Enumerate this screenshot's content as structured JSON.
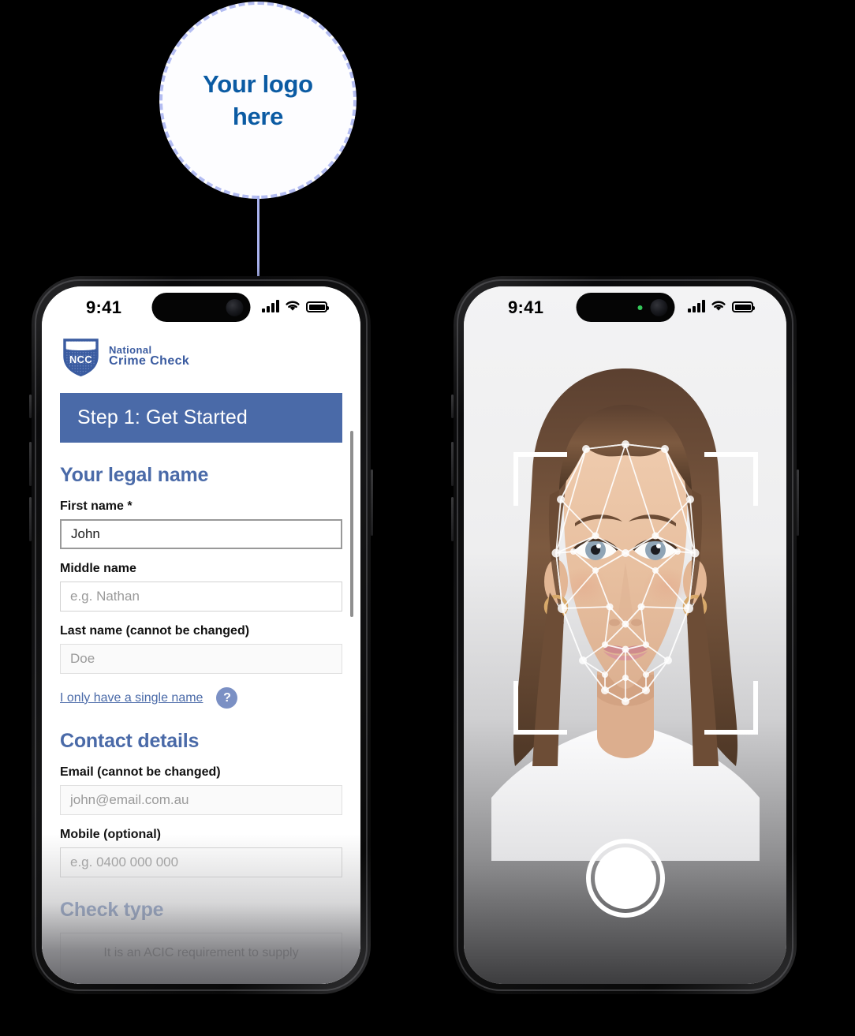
{
  "callout": {
    "line1": "Your logo",
    "line2": "here",
    "accent_color": "#0b5ba3",
    "border_color": "#b4bdf2",
    "connector_color": "#aab4f0"
  },
  "left_phone": {
    "status_bar": {
      "time": "9:41",
      "signal_icon": "cellular-bars-icon",
      "wifi_icon": "wifi-icon",
      "battery_icon": "battery-icon"
    },
    "header": {
      "logo_name": "ncc-shield-logo",
      "wordmark_line1": "National",
      "wordmark_line2": "Crime Check",
      "brand_color": "#3a5ba0"
    },
    "step_banner": {
      "label": "Step 1: Get Started",
      "background": "#4a6aa8"
    },
    "sections": [
      {
        "heading": "Your legal name",
        "fields": [
          {
            "label": "First name *",
            "value": "John",
            "placeholder": "",
            "state": "filled"
          },
          {
            "label": "Middle name",
            "value": "",
            "placeholder": "e.g. Nathan",
            "state": "empty"
          },
          {
            "label": "Last name (cannot be changed)",
            "value": "Doe",
            "placeholder": "",
            "state": "locked"
          }
        ],
        "link": "I only have a single name",
        "help_icon": "question-mark-icon",
        "help_glyph": "?"
      },
      {
        "heading": "Contact details",
        "fields": [
          {
            "label": "Email (cannot be changed)",
            "value": "john@email.com.au",
            "placeholder": "",
            "state": "locked"
          },
          {
            "label": "Mobile (optional)",
            "value": "",
            "placeholder": "e.g. 0400 000 000",
            "state": "empty"
          }
        ]
      },
      {
        "heading": "Check type",
        "note": "It is an ACIC requirement to supply"
      }
    ],
    "scrollbar": "vertical-scrollbar"
  },
  "right_phone": {
    "status_bar": {
      "time": "9:41",
      "camera_indicator": "green-camera-dot",
      "signal_icon": "cellular-bars-icon",
      "wifi_icon": "wifi-icon",
      "battery_icon": "battery-icon"
    },
    "camera": {
      "subject": "portrait-photo-woman",
      "overlay": "face-mesh-overlay",
      "brackets": "focus-corner-brackets",
      "shutter": "capture-shutter-button"
    }
  }
}
